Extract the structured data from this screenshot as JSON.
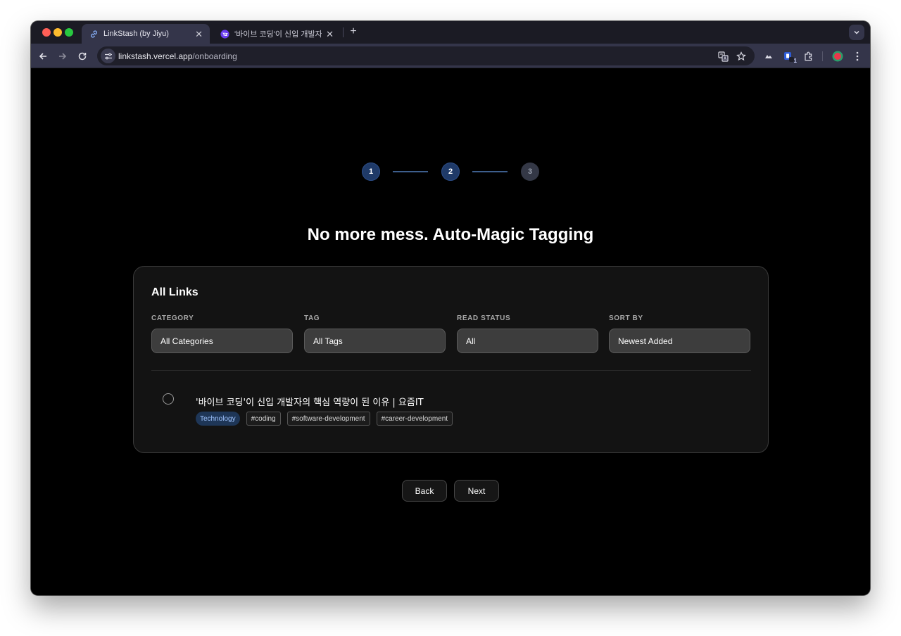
{
  "browser": {
    "tabs": [
      {
        "title": "LinkStash (by Jiyu)",
        "active": true,
        "icon": "link-icon"
      },
      {
        "title": "'바이브 코딩'이 신입 개발자의 핵심 역량이 된 이유 | 요즘IT",
        "active": false,
        "icon": "yozmit-icon"
      }
    ],
    "url_domain": "linkstash.vercel.app",
    "url_path": "/onboarding",
    "extension_badge": "1"
  },
  "onboarding": {
    "steps": [
      {
        "number": "1",
        "state": "done"
      },
      {
        "number": "2",
        "state": "current"
      },
      {
        "number": "3",
        "state": "todo"
      }
    ],
    "headline": "No more mess. Auto-Magic Tagging",
    "back_label": "Back",
    "next_label": "Next"
  },
  "card": {
    "title": "All Links",
    "filters": [
      {
        "label": "CATEGORY",
        "value": "All Categories"
      },
      {
        "label": "TAG",
        "value": "All Tags"
      },
      {
        "label": "READ STATUS",
        "value": "All"
      },
      {
        "label": "SORT BY",
        "value": "Newest Added"
      }
    ],
    "links": [
      {
        "title": "'바이브 코딩'이 신입 개발자의 핵심 역량이 된 이유 | 요즘IT",
        "category": "Technology",
        "tags": [
          "#coding",
          "#software-development",
          "#career-development"
        ]
      }
    ]
  },
  "colors": {
    "step_done": "#1f3a68",
    "step_todo": "#343846",
    "category_chip_bg": "#1e3657",
    "category_chip_text": "#9fc4ff"
  }
}
